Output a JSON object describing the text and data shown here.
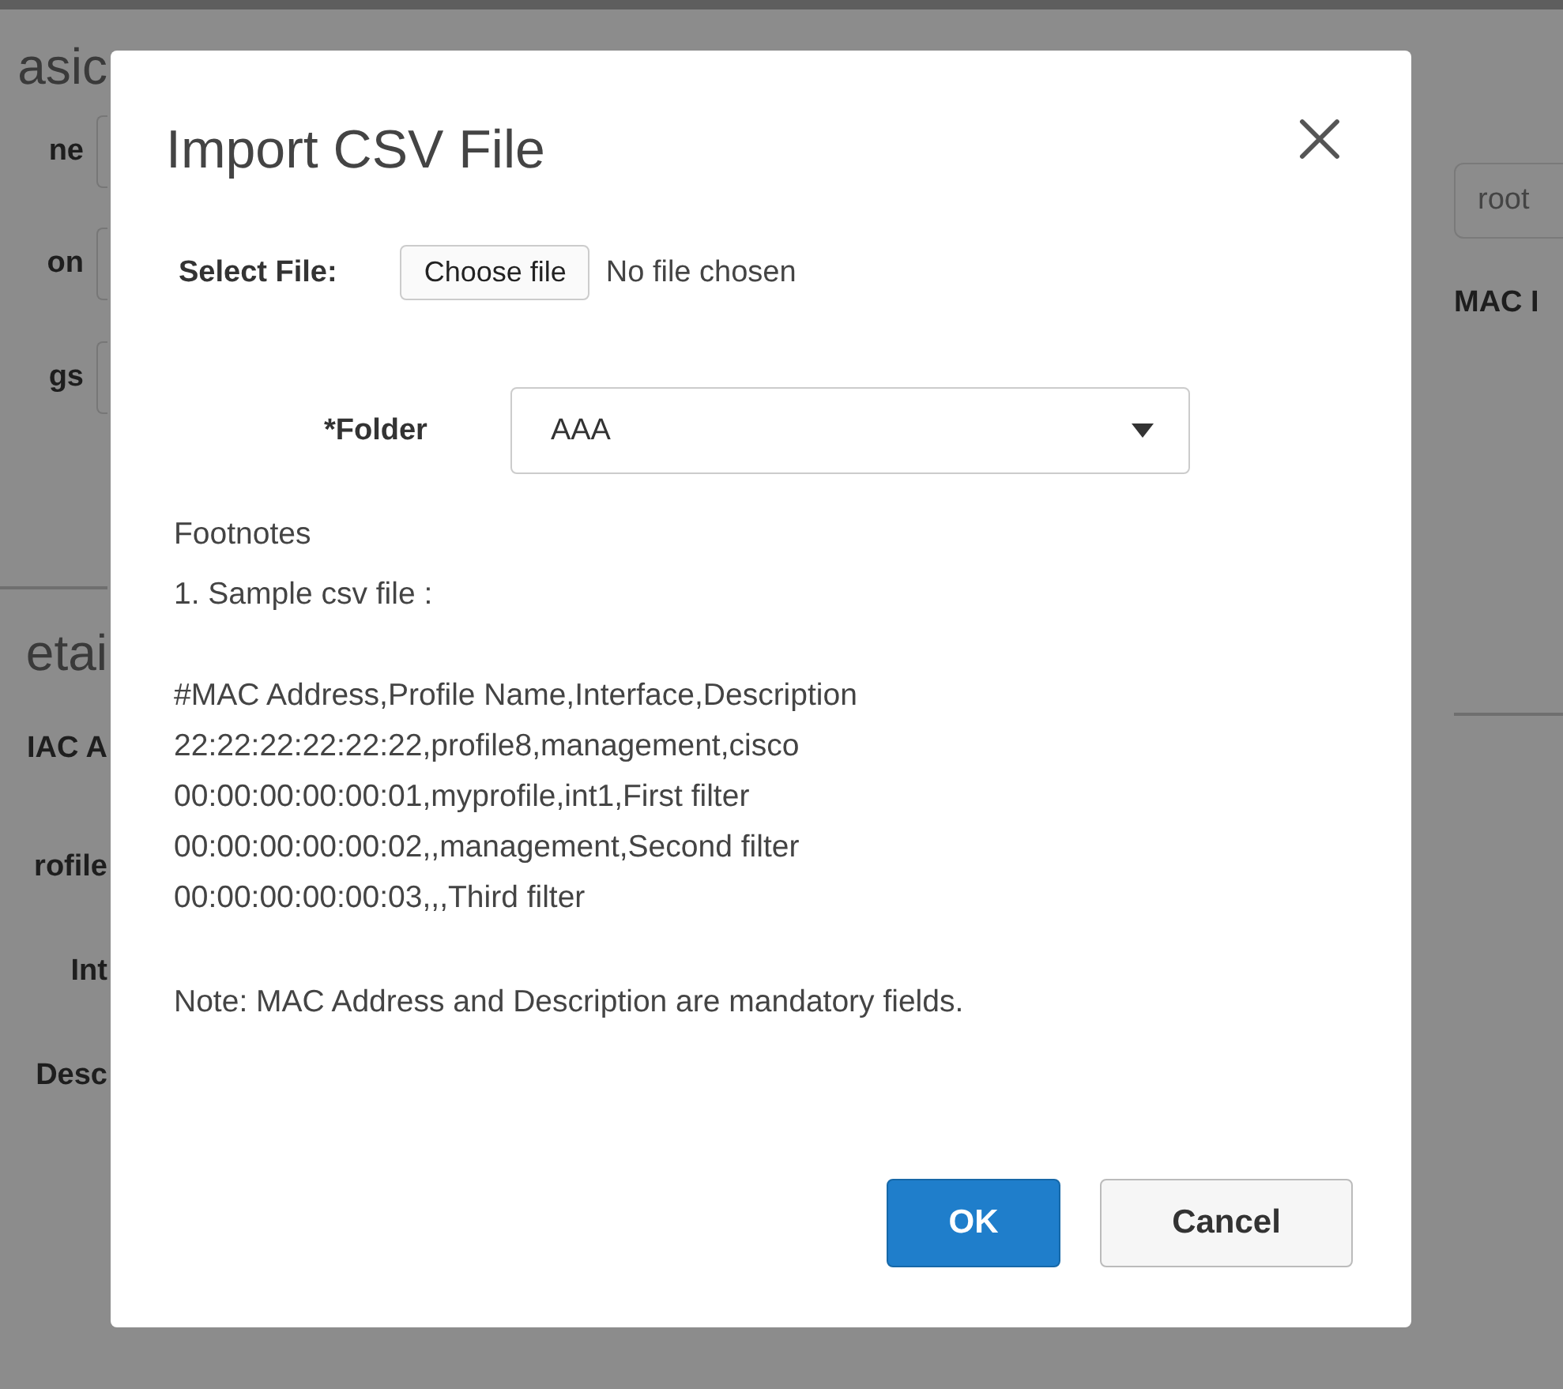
{
  "background": {
    "top_title": "asic",
    "top_labels": [
      "ne",
      "on",
      "gs"
    ],
    "bottom_title": "etai",
    "bottom_labels": [
      "IAC A",
      "rofile",
      "Int",
      "Desc"
    ],
    "right_field": {
      "value": "root"
    },
    "right_label": "MAC I"
  },
  "dialog": {
    "title": "Import CSV File",
    "select_file": {
      "label": "Select File:",
      "button": "Choose file",
      "status": "No file chosen"
    },
    "folder": {
      "label": "*Folder",
      "value": "AAA"
    },
    "footnotes_title": "Footnotes",
    "footnote": "1. Sample csv file :",
    "csv_lines": [
      "#MAC Address,Profile Name,Interface,Description",
      "22:22:22:22:22:22,profile8,management,cisco",
      "00:00:00:00:00:01,myprofile,int1,First filter",
      "00:00:00:00:00:02,,management,Second filter",
      "00:00:00:00:00:03,,,Third filter"
    ],
    "note": "Note: MAC Address and Description are mandatory fields.",
    "buttons": [
      {
        "label": "OK",
        "kind": "primary"
      },
      {
        "label": "Cancel",
        "kind": "secondary"
      }
    ]
  }
}
